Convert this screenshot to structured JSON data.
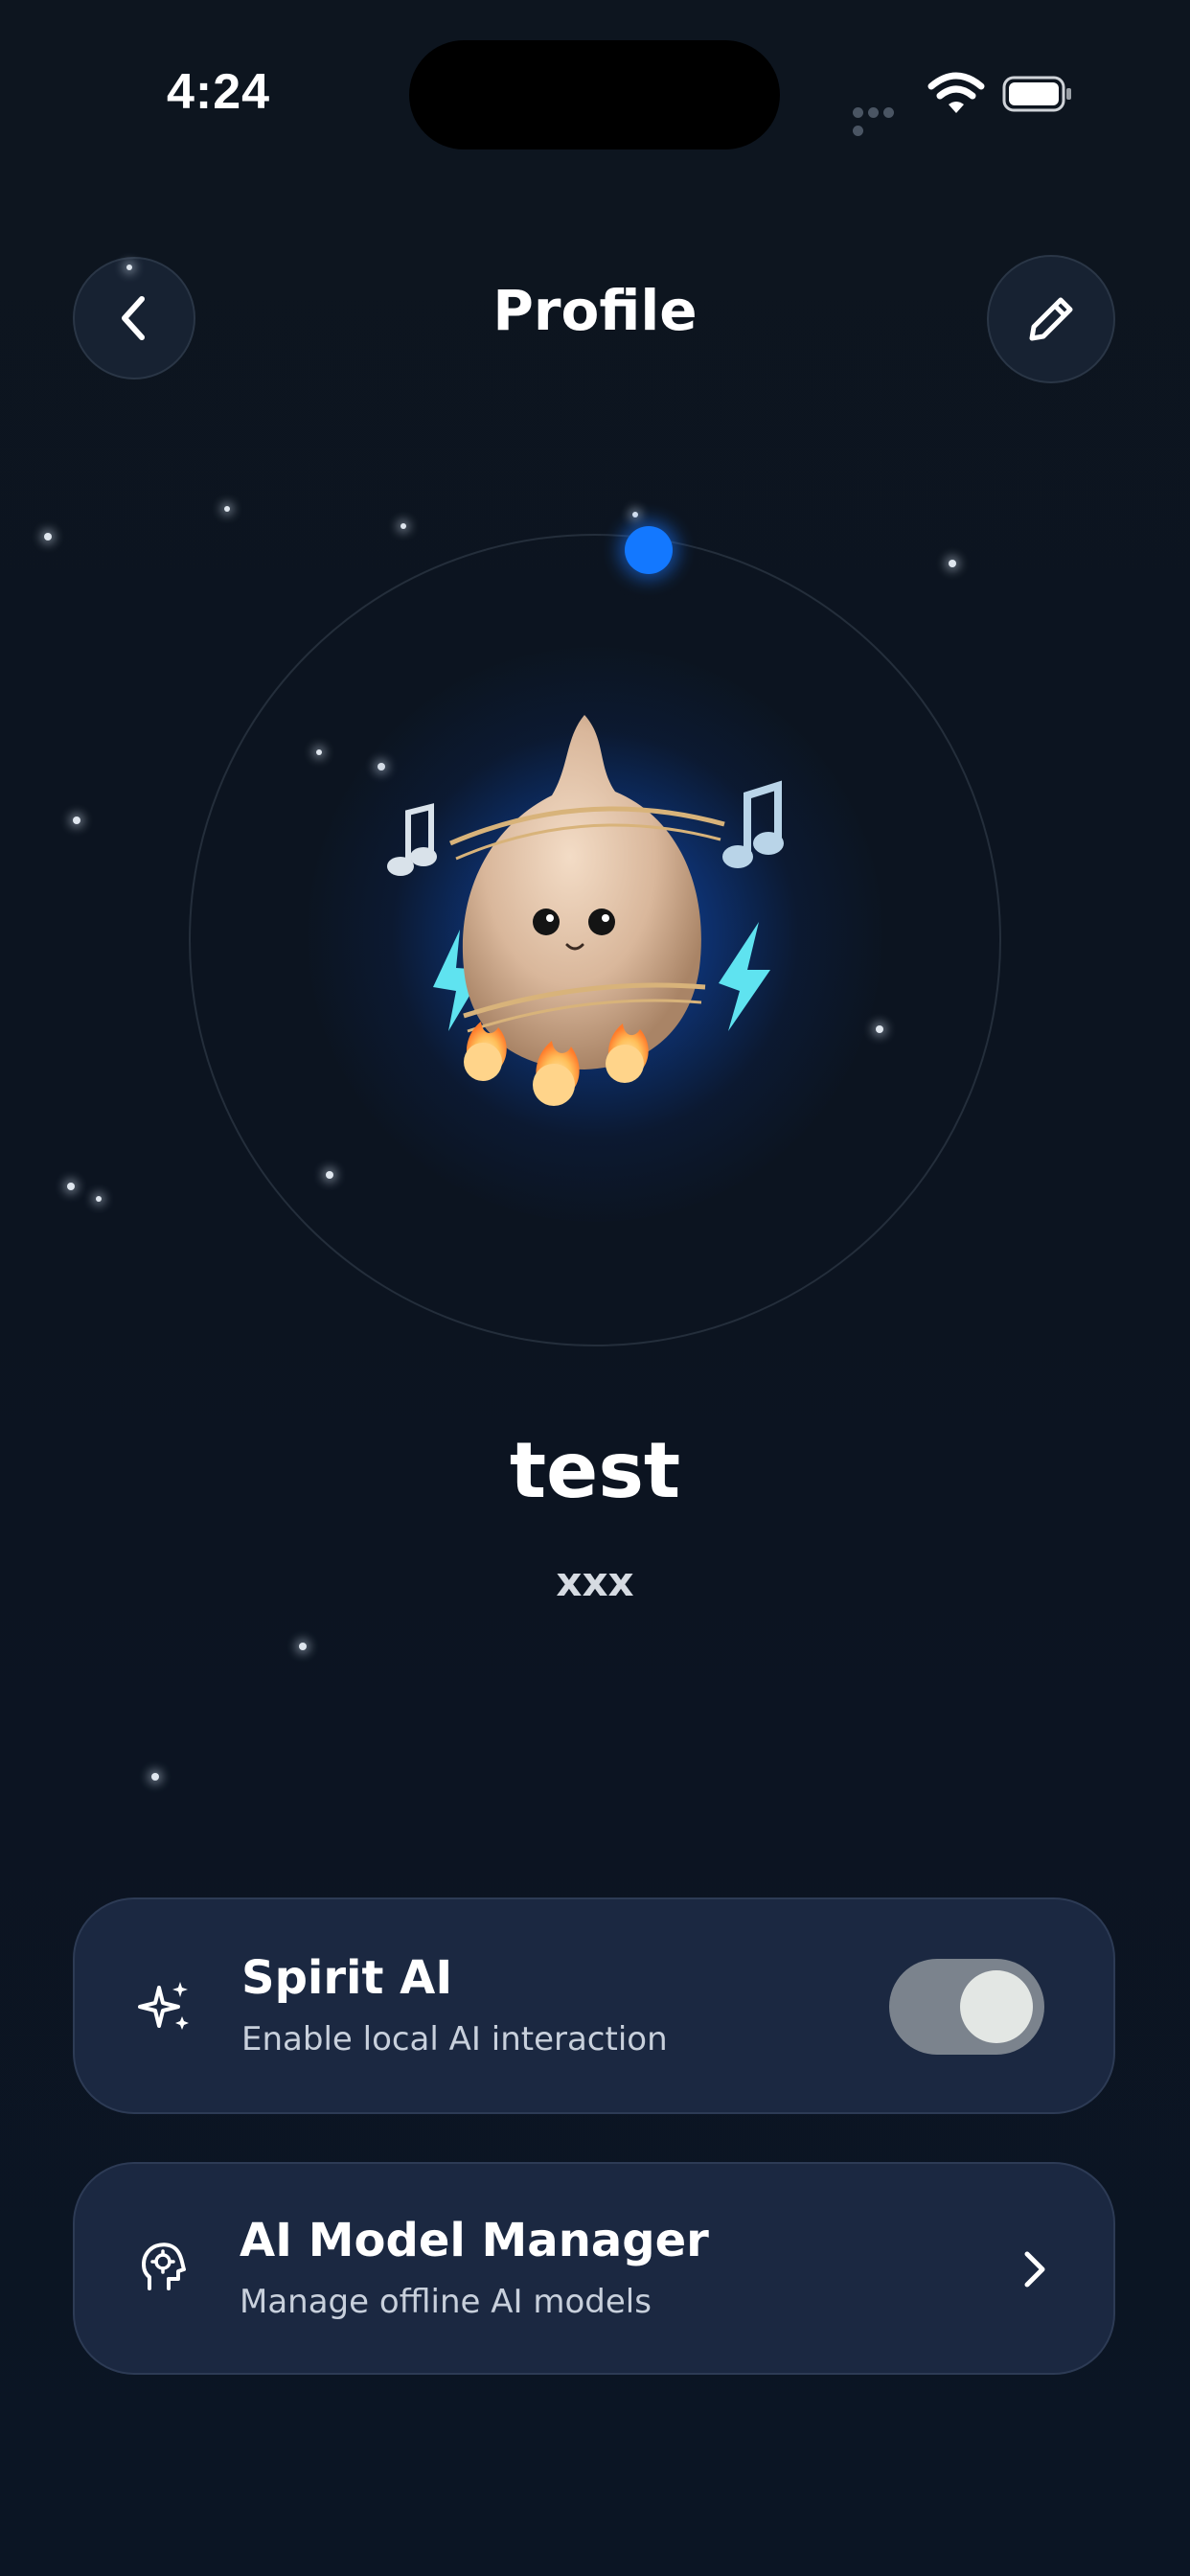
{
  "status_bar": {
    "time": "4:24"
  },
  "header": {
    "title": "Profile"
  },
  "profile": {
    "name": "test",
    "handle": "xxx"
  },
  "settings": {
    "spirit_ai": {
      "title": "Spirit AI",
      "subtitle": "Enable local AI interaction",
      "enabled": true
    },
    "model_manager": {
      "title": "AI Model Manager",
      "subtitle": "Manage offline AI models"
    }
  },
  "colors": {
    "background": "#0d1520",
    "card": "#1b2841",
    "accent": "#1378ff",
    "toggle_track": "#7b838d"
  },
  "icons": {
    "back": "chevron-left-icon",
    "edit": "pencil-icon",
    "spirit": "sparkles-icon",
    "model": "brain-head-icon",
    "chevron": "chevron-right-icon"
  }
}
